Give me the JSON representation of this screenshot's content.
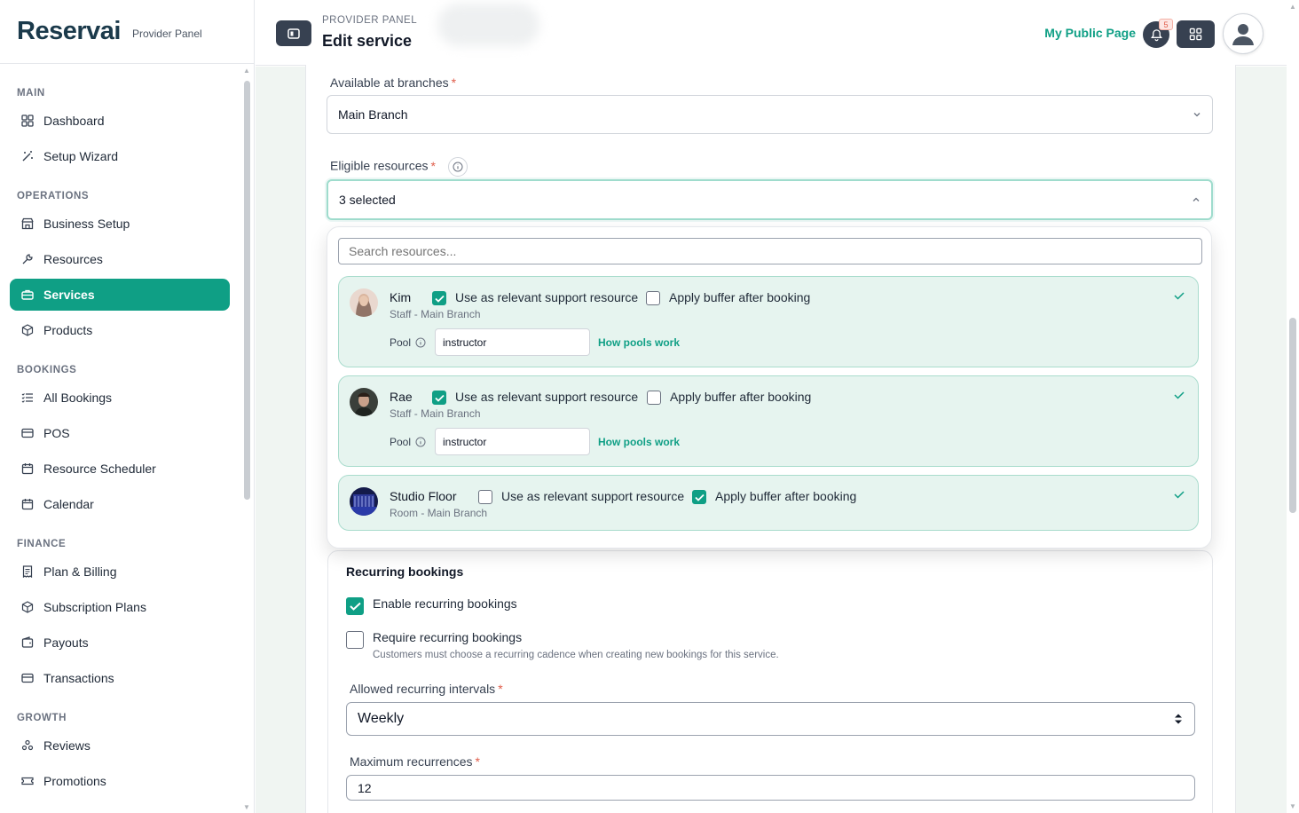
{
  "brand": {
    "logo": "Reservai",
    "panel_tag": "Provider Panel"
  },
  "sidebar": {
    "sections": [
      {
        "title": "MAIN",
        "items": [
          {
            "label": "Dashboard",
            "icon": "dashboard-icon"
          },
          {
            "label": "Setup Wizard",
            "icon": "wand-icon"
          }
        ]
      },
      {
        "title": "OPERATIONS",
        "items": [
          {
            "label": "Business Setup",
            "icon": "store-icon"
          },
          {
            "label": "Resources",
            "icon": "tools-icon"
          },
          {
            "label": "Services",
            "icon": "briefcase-icon",
            "active": true
          },
          {
            "label": "Products",
            "icon": "box-icon"
          }
        ]
      },
      {
        "title": "BOOKINGS",
        "items": [
          {
            "label": "All Bookings",
            "icon": "list-icon"
          },
          {
            "label": "POS",
            "icon": "card-icon"
          },
          {
            "label": "Resource Scheduler",
            "icon": "calendar-icon"
          },
          {
            "label": "Calendar",
            "icon": "calendar-icon"
          }
        ]
      },
      {
        "title": "FINANCE",
        "items": [
          {
            "label": "Plan & Billing",
            "icon": "receipt-icon"
          },
          {
            "label": "Subscription Plans",
            "icon": "box-icon"
          },
          {
            "label": "Payouts",
            "icon": "wallet-icon"
          },
          {
            "label": "Transactions",
            "icon": "card-icon"
          }
        ]
      },
      {
        "title": "GROWTH",
        "items": [
          {
            "label": "Reviews",
            "icon": "people-icon"
          },
          {
            "label": "Promotions",
            "icon": "ticket-icon"
          }
        ]
      }
    ]
  },
  "header": {
    "breadcrumb": "PROVIDER PANEL",
    "title": "Edit service",
    "public_page": "My Public Page",
    "notification_count": "5"
  },
  "form": {
    "branches": {
      "label": "Available at branches",
      "required": "*",
      "value": "Main Branch"
    },
    "resources": {
      "label": "Eligible resources",
      "required": "*",
      "value": "3 selected"
    },
    "search_placeholder": "Search resources...",
    "resource_list": [
      {
        "name": "Kim",
        "sub": "Staff - Main Branch",
        "support": true,
        "buffer": false,
        "support_label": "Use as relevant support resource",
        "buffer_label": "Apply buffer after booking",
        "pool_label": "Pool",
        "pool_value": "instructor",
        "pool_link": "How pools work"
      },
      {
        "name": "Rae",
        "sub": "Staff - Main Branch",
        "support": true,
        "buffer": false,
        "support_label": "Use as relevant support resource",
        "buffer_label": "Apply buffer after booking",
        "pool_label": "Pool",
        "pool_value": "instructor",
        "pool_link": "How pools work"
      },
      {
        "name": "Studio Floor",
        "sub": "Room - Main Branch",
        "support": false,
        "buffer": true,
        "support_label": "Use as relevant support resource",
        "buffer_label": "Apply buffer after booking"
      }
    ],
    "recurring": {
      "title": "Recurring bookings",
      "enable_label": "Enable recurring bookings",
      "enable_checked": true,
      "require_label": "Require recurring bookings",
      "require_checked": false,
      "require_help": "Customers must choose a recurring cadence when creating new bookings for this service.",
      "intervals_label": "Allowed recurring intervals",
      "intervals_required": "*",
      "intervals_value": "Weekly",
      "max_label": "Maximum recurrences",
      "max_required": "*",
      "max_value": "12"
    }
  },
  "colors": {
    "accent": "#0f9f85",
    "dark": "#374151",
    "resource_bg": "#e6f4ef"
  }
}
